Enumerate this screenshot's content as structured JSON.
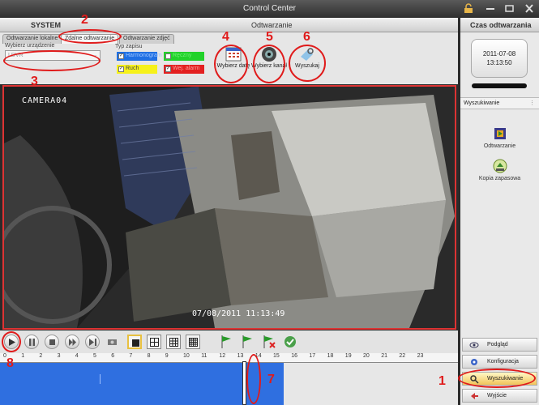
{
  "window": {
    "title": "Control Center"
  },
  "headers": {
    "system": "SYSTEM",
    "playback": "Odtwarzanie",
    "time": "Czas odtwarzania"
  },
  "tabs": [
    {
      "label": "Odtwarzanie lokalne",
      "active": false
    },
    {
      "label": "Zdalne odtwarzanie",
      "active": true
    },
    {
      "label": "Odtwarzanie zdjęć",
      "active": false
    }
  ],
  "device": {
    "label": "Wybierz urządzenie",
    "value": "LDVR"
  },
  "record_type": {
    "label": "Typ zapisu",
    "options": [
      {
        "label": "Harmonogram",
        "checked": true,
        "color": "#1f6fe3"
      },
      {
        "label": "Ręczny",
        "checked": false,
        "color": "#22d22a"
      },
      {
        "label": "Ruch",
        "checked": true,
        "color": "#f6f11a"
      },
      {
        "label": "Wej. alarm",
        "checked": true,
        "color": "#e32020"
      }
    ]
  },
  "actions": {
    "pick_date": "Wybierz datę",
    "pick_channel": "Wybierz kanał",
    "search": "Wyszukaj"
  },
  "clock": {
    "date": "2011-07-08",
    "time": "13:13:50"
  },
  "right_panel": {
    "section": "Wyszukiwanie",
    "items": [
      {
        "label": "Odtwarzanie"
      },
      {
        "label": "Kopia zapasowa"
      }
    ]
  },
  "menu": [
    {
      "label": "Podgląd",
      "active": false
    },
    {
      "label": "Konfiguracja",
      "active": false
    },
    {
      "label": "Wyszukiwanie",
      "active": true
    },
    {
      "label": "Wyjście",
      "active": false
    }
  ],
  "video": {
    "camera": "CAMERA04",
    "timestamp": "07/08/2011 11:13:49"
  },
  "timeline": {
    "hours": [
      "0",
      "1",
      "2",
      "3",
      "4",
      "5",
      "6",
      "7",
      "8",
      "9",
      "10",
      "11",
      "12",
      "13",
      "14",
      "15",
      "16",
      "17",
      "18",
      "19",
      "20",
      "21",
      "22",
      "23"
    ],
    "recorded_until_hour": 15.5,
    "cursor_hour": 13.2
  },
  "annotations": [
    "1",
    "2",
    "3",
    "4",
    "5",
    "6",
    "7",
    "8"
  ],
  "colors": {
    "accent": "#e01b1b",
    "timeline": "#2f6fe0"
  }
}
